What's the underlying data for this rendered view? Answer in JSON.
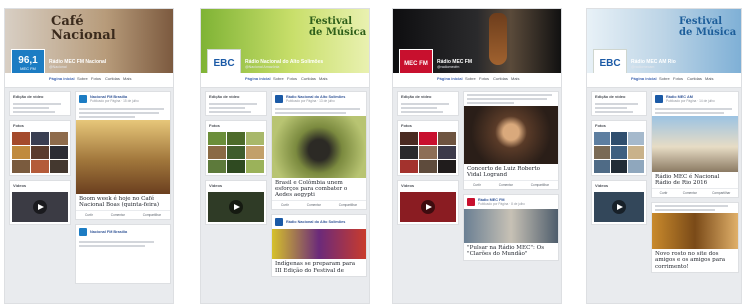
{
  "panels": [
    {
      "cover_title": "Café\nNacional",
      "page_name": "Rádio MEC FM Nacional",
      "page_handle": "@Nacional",
      "logo_text": "96,1",
      "logo_sub": "MEC FM",
      "nav_tabs": [
        "Página inicial",
        "Sobre",
        "Fotos",
        "Curtidas",
        "Mais"
      ],
      "action_buttons": [
        "Curtir",
        "Mensagem",
        "..."
      ],
      "left_cards": [
        "Edição de vídeo",
        "Fotos",
        "Vídeos"
      ],
      "post_name": "Nacional FM Brasília",
      "post_meta": "Publicado por Página · 15 de julho",
      "caption": "Boom week é hoje no Café Nacional Boas (quinta-feira)",
      "action_labels": [
        "Curtir",
        "Comentar",
        "Compartilhar"
      ],
      "accent": "#3b5998"
    },
    {
      "cover_title": "Festival\nde Música",
      "page_name": "Rádio Nacional do Alto Solimões",
      "page_handle": "@Nacional Amazônia",
      "logo_text": "EBC",
      "logo_sub": "",
      "nav_tabs": [
        "Página inicial",
        "Sobre",
        "Fotos",
        "Curtidas",
        "Mais"
      ],
      "action_buttons": [
        "Curtir",
        "Mensagem",
        "..."
      ],
      "left_cards": [
        "Edição de vídeo",
        "Fotos",
        "Vídeos"
      ],
      "post_name": "Rádio Nacional do Alto Solimões",
      "post_meta": "Publicado por Página · 13 de julho",
      "caption": "Brasil e Colômbia unem esforços para combater o Aedes aegypti",
      "caption2": "Indígenas se preparam para III Edição do Festival de",
      "action_labels": [
        "Curtir",
        "Comentar",
        "Compartilhar"
      ],
      "accent": "#6a9a1f"
    },
    {
      "cover_title": "",
      "page_name": "Rádio MEC FM",
      "page_handle": "@radiomecfm",
      "logo_text": "MEC FM",
      "logo_sub": "",
      "nav_tabs": [
        "Página inicial",
        "Sobre",
        "Fotos",
        "Curtidas",
        "Mais"
      ],
      "action_buttons": [
        "Curtir",
        "Mensagem",
        "..."
      ],
      "left_cards": [
        "Edição de vídeo",
        "Fotos",
        "Vídeos"
      ],
      "post_name": "Rádio MEC FM",
      "post_meta": "Publicado por Página · 8 de julho",
      "caption": "Concerto de Luiz Roberto Vidal Logrand",
      "caption2": "\"Pulsar na Rádio MEC\": Os \"Clarões do Mundão\"",
      "action_labels": [
        "Curtir",
        "Comentar",
        "Compartilhar"
      ],
      "accent": "#b3122b"
    },
    {
      "cover_title": "Festival\nde Música",
      "page_name": "Rádio MEC AM Rio",
      "page_handle": "@radiomecam",
      "logo_text": "EBC",
      "logo_sub": "",
      "nav_tabs": [
        "Página inicial",
        "Sobre",
        "Fotos",
        "Curtidas",
        "Mais"
      ],
      "action_buttons": [
        "Curtir",
        "Mensagem",
        "..."
      ],
      "left_cards": [
        "Edição de vídeo",
        "Fotos",
        "Vídeos"
      ],
      "post_name": "Rádio MEC AM",
      "post_meta": "Publicado por Página · 14 de julho",
      "caption": "Rádio MEC é Nacional Rádio de Rio 2016",
      "caption2": "Novo rosto no site dos amigos e os amigos para corrimento!",
      "action_labels": [
        "Curtir",
        "Comentar",
        "Compartilhar"
      ],
      "accent": "#2b6fb4"
    }
  ]
}
